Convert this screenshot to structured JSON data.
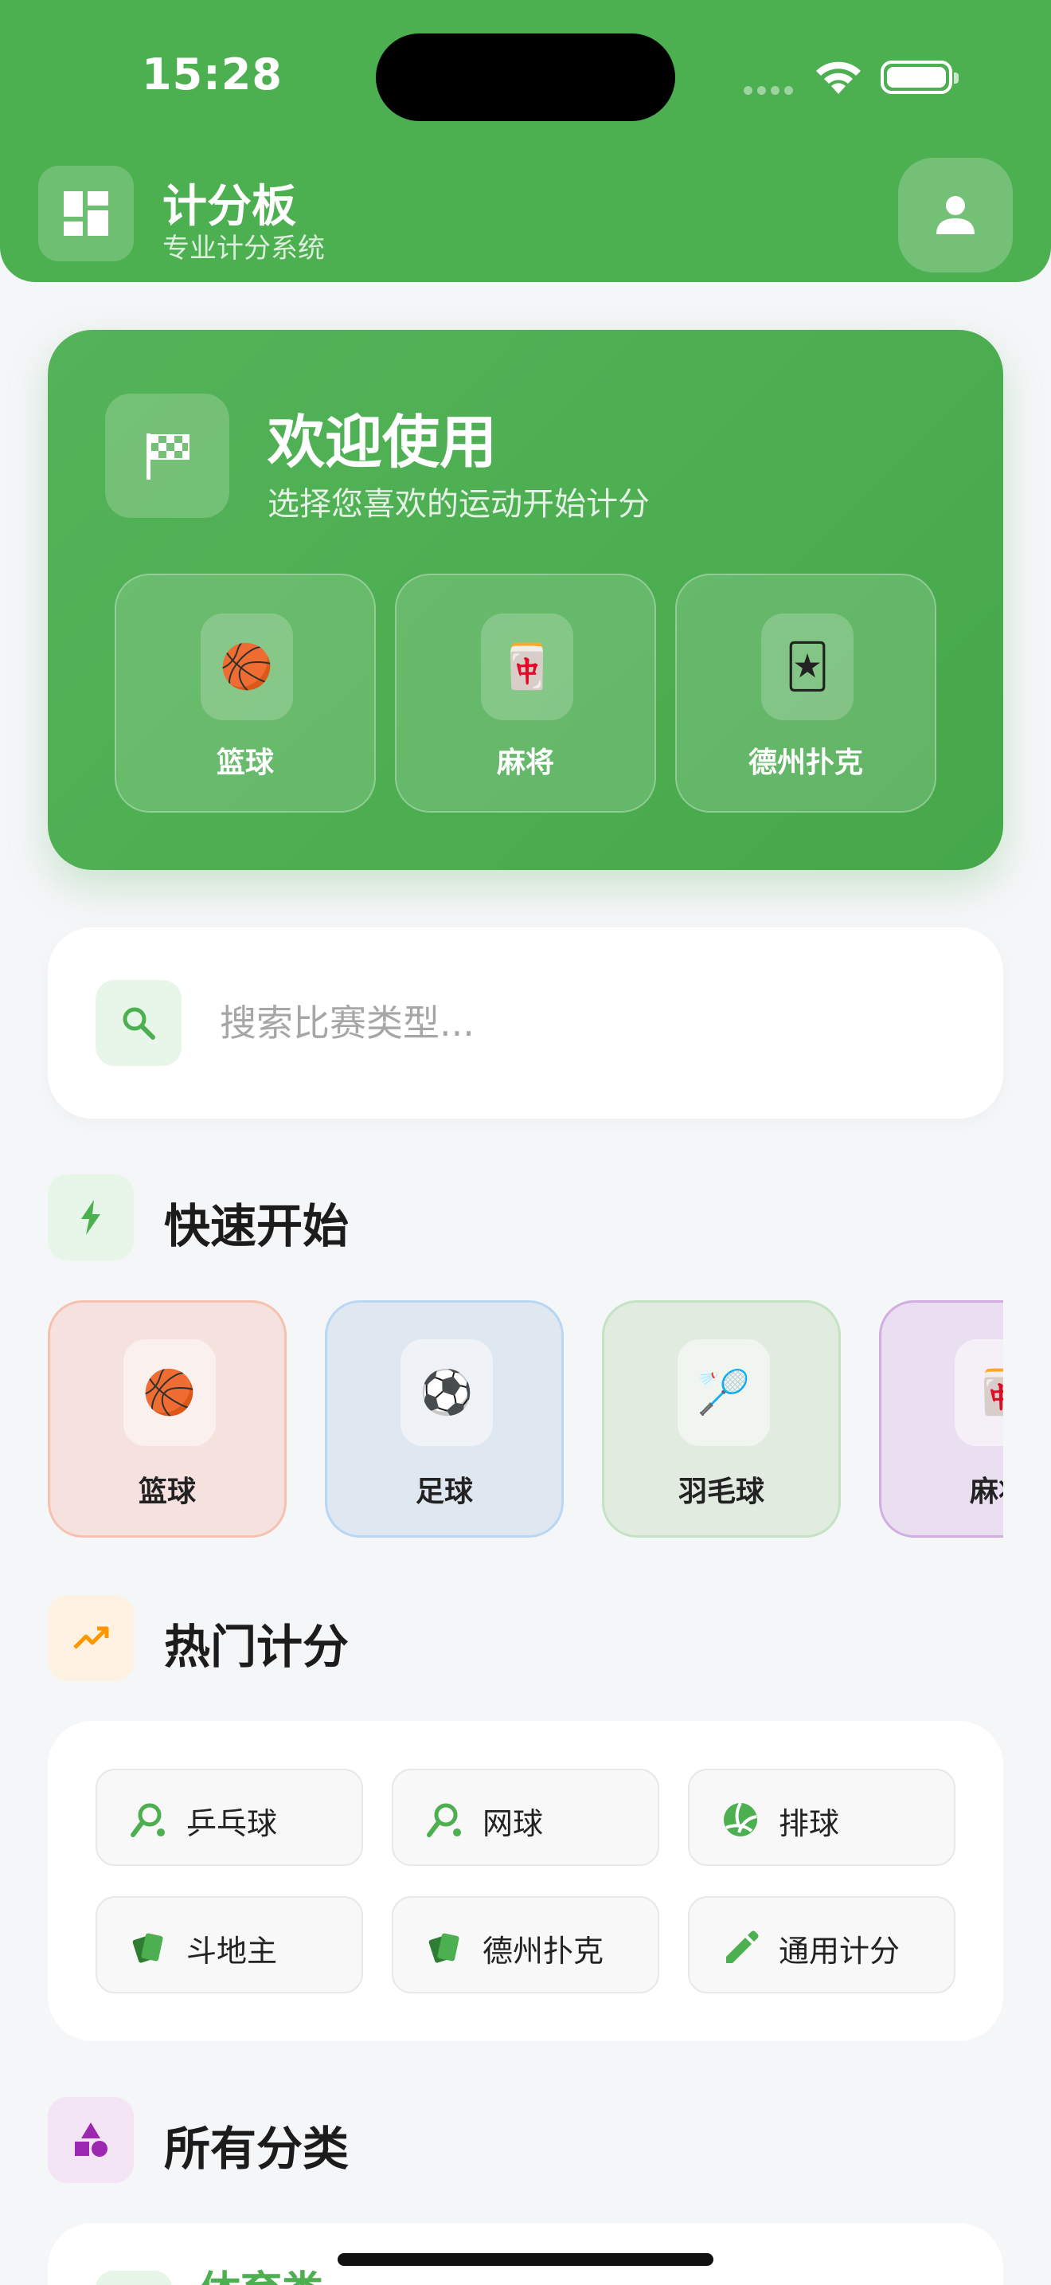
{
  "status_bar": {
    "time": "15:28"
  },
  "header": {
    "title": "计分板",
    "subtitle": "专业计分系统"
  },
  "welcome": {
    "title": "欢迎使用",
    "subtitle": "选择您喜欢的运动开始计分",
    "tiles": [
      {
        "label": "篮球",
        "emoji": "🏀"
      },
      {
        "label": "麻将",
        "emoji": "🀄"
      },
      {
        "label": "德州扑克",
        "emoji": "🃏"
      }
    ]
  },
  "search": {
    "placeholder": "搜索比赛类型..."
  },
  "quick_start": {
    "title": "快速开始",
    "items": [
      {
        "label": "篮球",
        "emoji": "🏀",
        "bg": "#f5e1dd",
        "border": "#f6c1b0"
      },
      {
        "label": "足球",
        "emoji": "⚽",
        "bg": "#dfe7f1",
        "border": "#b9d7f3"
      },
      {
        "label": "羽毛球",
        "emoji": "🏸",
        "bg": "#e1ebe0",
        "border": "#c3e3c3"
      },
      {
        "label": "麻将",
        "emoji": "🀄",
        "bg": "#eadff0",
        "border": "#d2aee0"
      }
    ]
  },
  "popular": {
    "title": "热门计分",
    "items": [
      {
        "label": "乒乓球",
        "icon": "racket-icon"
      },
      {
        "label": "网球",
        "icon": "racket-icon"
      },
      {
        "label": "排球",
        "icon": "volleyball-icon"
      },
      {
        "label": "斗地主",
        "icon": "cards-icon"
      },
      {
        "label": "德州扑克",
        "icon": "cards-icon"
      },
      {
        "label": "通用计分",
        "icon": "pencil-icon"
      }
    ]
  },
  "all_categories": {
    "title": "所有分类",
    "first_label": "体育类"
  },
  "colors": {
    "primary": "#4caf50",
    "orange": "#ff9800",
    "purple": "#9c27b0"
  }
}
